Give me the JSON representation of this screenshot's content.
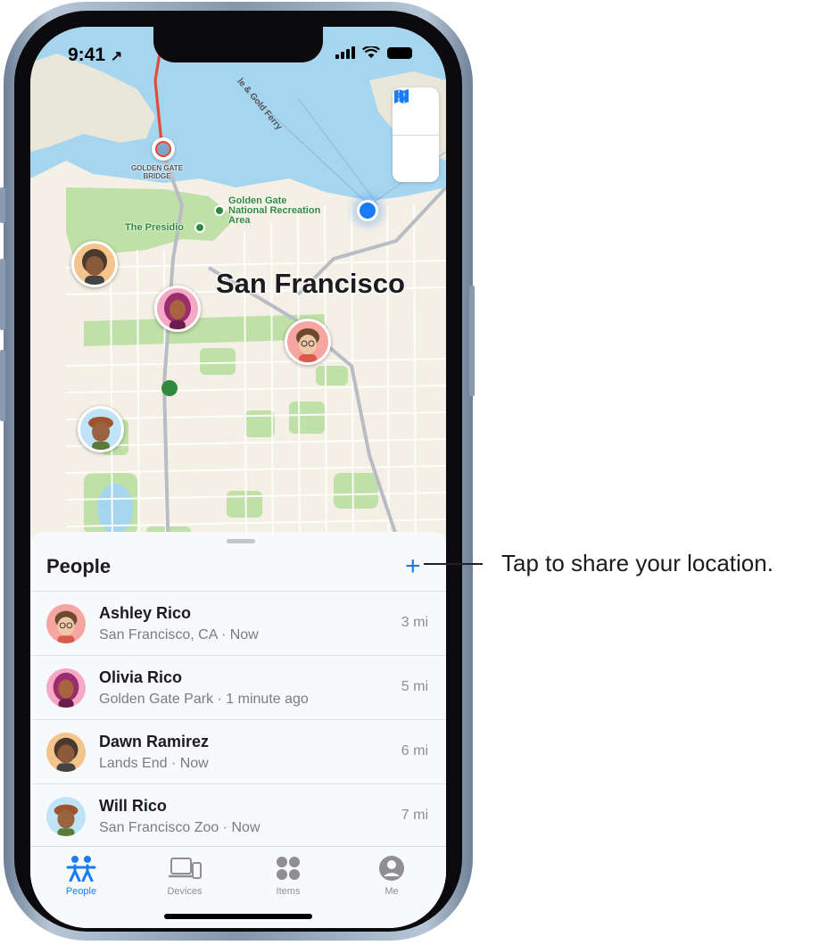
{
  "status_bar": {
    "time": "9:41"
  },
  "map": {
    "city_label": "San Francisco",
    "poi_golden_gate_bridge": "GOLDEN GATE BRIDGE",
    "poi_golden_gate_park_area": "Golden Gate National Recreation Area",
    "poi_presidio": "The Presidio",
    "road_label": "le & Gold Ferry",
    "controls": {
      "map_icon": "map-icon",
      "location_icon": "location-arrow-icon"
    }
  },
  "sheet": {
    "title": "People",
    "add_label": "+",
    "people": [
      {
        "name": "Ashley Rico",
        "detail": "San Francisco, CA · Now",
        "distance": "3 mi"
      },
      {
        "name": "Olivia Rico",
        "detail": "Golden Gate Park · 1 minute ago",
        "distance": "5 mi"
      },
      {
        "name": "Dawn Ramirez",
        "detail": "Lands End · Now",
        "distance": "6 mi"
      },
      {
        "name": "Will Rico",
        "detail": "San Francisco Zoo · Now",
        "distance": "7 mi"
      }
    ]
  },
  "tabs": [
    {
      "label": "People",
      "icon": "people-icon",
      "active": true
    },
    {
      "label": "Devices",
      "icon": "devices-icon",
      "active": false
    },
    {
      "label": "Items",
      "icon": "items-icon",
      "active": false
    },
    {
      "label": "Me",
      "icon": "person-circle-icon",
      "active": false
    }
  ],
  "callout": {
    "text": "Tap to share your location."
  },
  "colors": {
    "accent": "#1a7cf4",
    "water": "#a6d6ef",
    "land": "#f4f0e6",
    "park": "#bfe0a6"
  }
}
